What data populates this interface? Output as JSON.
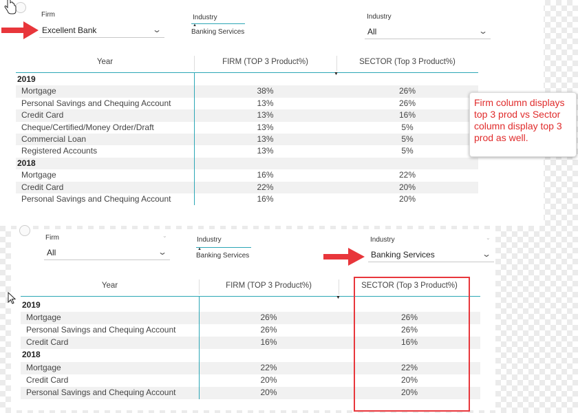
{
  "panel1": {
    "firm_label": "Firm",
    "firm_value": "Excellent Bank",
    "industry1_label": "Industry",
    "industry1_chip": "Banking Services",
    "industry2_label": "Industry",
    "industry2_value": "All",
    "table": {
      "headers": [
        "Year",
        "FIRM (TOP 3 Product%)",
        "SECTOR (Top 3 Product%)"
      ],
      "rows": [
        {
          "type": "year",
          "label": "2019",
          "firm": "",
          "sector": ""
        },
        {
          "type": "item",
          "label": "Mortgage",
          "firm": "38%",
          "sector": "26%"
        },
        {
          "type": "item",
          "label": "Personal Savings and Chequing Account",
          "firm": "13%",
          "sector": "26%"
        },
        {
          "type": "item",
          "label": "Credit Card",
          "firm": "13%",
          "sector": "16%"
        },
        {
          "type": "item",
          "label": "Cheque/Certified/Money Order/Draft",
          "firm": "13%",
          "sector": "5%"
        },
        {
          "type": "item",
          "label": "Commercial Loan",
          "firm": "13%",
          "sector": "5%"
        },
        {
          "type": "item",
          "label": "Registered Accounts",
          "firm": "13%",
          "sector": "5%"
        },
        {
          "type": "year",
          "label": "2018",
          "firm": "",
          "sector": ""
        },
        {
          "type": "item",
          "label": "Mortgage",
          "firm": "16%",
          "sector": "22%"
        },
        {
          "type": "item",
          "label": "Credit Card",
          "firm": "22%",
          "sector": "20%"
        },
        {
          "type": "item",
          "label": "Personal Savings and Chequing Account",
          "firm": "16%",
          "sector": "20%"
        }
      ]
    }
  },
  "callout": {
    "text": "Firm column displays top 3 prod vs Sector column display top 3 prod as well.",
    "color": "#e02b2b"
  },
  "panel2": {
    "firm_label": "Firm",
    "firm_value": "All",
    "industry1_label": "Industry",
    "industry1_chip": "Banking Services",
    "industry2_label": "Industry",
    "industry2_value": "Banking Services",
    "table": {
      "headers": [
        "Year",
        "FIRM (TOP 3 Product%)",
        "SECTOR (Top 3 Product%)"
      ],
      "rows": [
        {
          "type": "year",
          "label": "2019",
          "firm": "",
          "sector": ""
        },
        {
          "type": "item",
          "label": "Mortgage",
          "firm": "26%",
          "sector": "26%"
        },
        {
          "type": "item",
          "label": "Personal Savings and Chequing Account",
          "firm": "26%",
          "sector": "26%"
        },
        {
          "type": "item",
          "label": "Credit Card",
          "firm": "16%",
          "sector": "16%"
        },
        {
          "type": "year",
          "label": "2018",
          "firm": "",
          "sector": ""
        },
        {
          "type": "item",
          "label": "Mortgage",
          "firm": "22%",
          "sector": "22%"
        },
        {
          "type": "item",
          "label": "Credit Card",
          "firm": "20%",
          "sector": "20%"
        },
        {
          "type": "item",
          "label": "Personal Savings and Chequing Account",
          "firm": "20%",
          "sector": "20%"
        }
      ]
    }
  },
  "colors": {
    "accent": "#2aa6b5",
    "annotation_red": "#e8363b",
    "row_shade": "#f1f1f1"
  },
  "icons": [
    "hand-cursor-icon",
    "pointer-cursor-icon",
    "chevron-down-icon",
    "sort-descending-icon",
    "red-arrow-icon"
  ]
}
